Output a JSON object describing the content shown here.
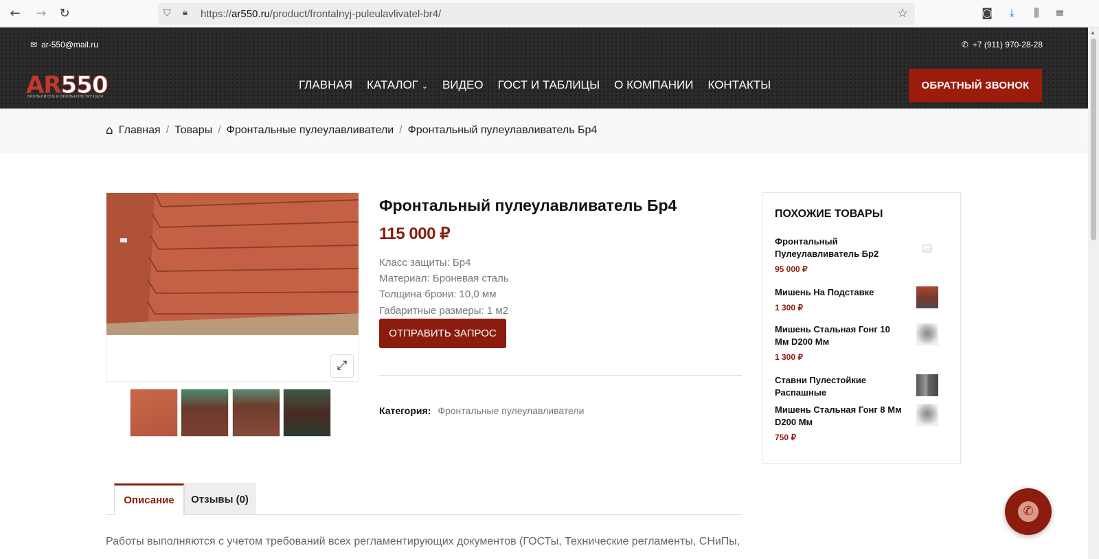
{
  "browser": {
    "url_prefix": "https://",
    "url_domain": "ar550.ru",
    "url_path": "/product/frontalnyj-puleulavlivatel-br4/"
  },
  "header": {
    "email": "ar-550@mail.ru",
    "phone": "+7 (911) 970-28-28",
    "logo_text_a": "AR",
    "logo_text_b": "550",
    "logo_sub": "БРОНЕЛИСТЫ И БРОНЕКОНСТРУКЦИИ",
    "menu": [
      {
        "label": "ГЛАВНАЯ"
      },
      {
        "label": "КАТАЛОГ"
      },
      {
        "label": "ВИДЕО"
      },
      {
        "label": "ГОСТ И ТАБЛИЦЫ"
      },
      {
        "label": "О КОМПАНИИ"
      },
      {
        "label": "КОНТАКТЫ"
      }
    ],
    "callback_label": "ОБРАТНЫЙ ЗВОНОК"
  },
  "breadcrumb": [
    "Главная",
    "Товары",
    "Фронтальные пулеулавливатели",
    "Фронтальный пулеулавливатель Бр4"
  ],
  "product": {
    "title": "Фронтальный пулеулавливатель Бр4",
    "price": "115 000 ₽",
    "specs": [
      "Класс защиты: Бр4",
      "Материал: Броневая сталь",
      "Толщина брони: 10,0 мм",
      "Габаритные размеры: 1 м2"
    ],
    "request_label": "ОТПРАВИТЬ ЗАПРОС",
    "category_label": "Категория:",
    "category_value": "Фронтальные пулеулавливатели"
  },
  "related": {
    "title": "ПОХОЖИЕ ТОВАРЫ",
    "items": [
      {
        "name": "Фронтальный Пулеулавливатель Бр2",
        "price": "95 000 ₽"
      },
      {
        "name": "Мишень На Подставке",
        "price": "1 300 ₽"
      },
      {
        "name": "Мишень Стальная Гонг 10 Мм D200 Мм",
        "price": "1 300 ₽"
      },
      {
        "name": "Ставни Пулестойкие Распашные",
        "price": ""
      },
      {
        "name": "Мишень Стальная Гонг 8 Мм D200 Мм",
        "price": "750 ₽"
      }
    ]
  },
  "tabs": {
    "description": "Описание",
    "reviews": "Отзывы (0)"
  },
  "description_text": "Работы выполняются с учетом требований всех регламентирующих документов (ГОСТы, Технические регламенты, СНиПы,",
  "colors": {
    "accent": "#8b1c0e",
    "header_bg": "#2b2b2b"
  }
}
